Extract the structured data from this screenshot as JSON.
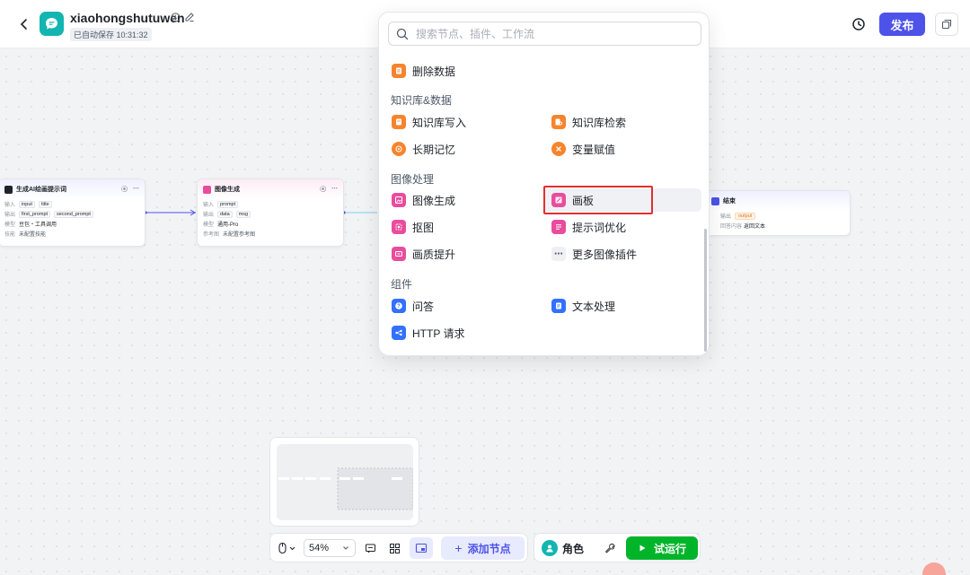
{
  "header": {
    "app_name": "xiaohongshutuwen",
    "save_status": "已自动保存 10:31:32",
    "publish_label": "发布",
    "icons": {
      "back": "chevron-left-icon",
      "logo": "chat-bubble-icon",
      "info": "info-icon",
      "edit": "edit-icon",
      "history": "history-icon",
      "copy": "copy-icon"
    }
  },
  "nodes": {
    "prompt_gen": {
      "title": "生成AI绘画提示词",
      "input_label": "输入",
      "inputs": [
        "input",
        "title"
      ],
      "output_label": "输出",
      "outputs": [
        "first_prompt",
        "second_prompt"
      ],
      "model_label": "模型",
      "model": "豆包・工具调用",
      "skill_label": "技能",
      "skill": "未配置技能"
    },
    "image_gen": {
      "title": "图像生成",
      "input_label": "输入",
      "input": "prompt",
      "output_label": "输出",
      "outputs": [
        "data",
        "msg"
      ],
      "model_label": "模型",
      "model": "通用-Pro",
      "ref_label": "参考图",
      "ref": "未配置参考图"
    },
    "end": {
      "title": "结束",
      "output_label": "输出",
      "output": "output",
      "answer_label": "回答内容",
      "answer": "返回文本"
    }
  },
  "panel": {
    "search_placeholder": "搜索节点、插件、工作流",
    "top_item": "删除数据",
    "categories": [
      {
        "title": "知识库&数据",
        "items": [
          {
            "label": "知识库写入",
            "color": "#f7842d"
          },
          {
            "label": "知识库检索",
            "color": "#f7842d"
          },
          {
            "label": "长期记忆",
            "color": "#f7842d"
          },
          {
            "label": "变量赋值",
            "color": "#f7842d"
          }
        ]
      },
      {
        "title": "图像处理",
        "items": [
          {
            "label": "图像生成",
            "color": "#ea4c9d"
          },
          {
            "label": "画板",
            "color": "#ea4c9d"
          },
          {
            "label": "抠图",
            "color": "#ea4c9d"
          },
          {
            "label": "提示词优化",
            "color": "#ea4c9d"
          },
          {
            "label": "画质提升",
            "color": "#ea4c9d"
          },
          {
            "label": "更多图像插件",
            "color": "#8f959e"
          }
        ]
      },
      {
        "title": "组件",
        "items": [
          {
            "label": "问答",
            "color": "#3370ff"
          },
          {
            "label": "文本处理",
            "color": "#3370ff"
          },
          {
            "label": "HTTP 请求",
            "color": "#3370ff"
          }
        ]
      }
    ]
  },
  "toolbar": {
    "zoom": "54%",
    "add_node_label": "添加节点",
    "role_label": "角色",
    "test_run_label": "试运行"
  },
  "colors": {
    "primary": "#4d53e8",
    "success": "#00b42a",
    "highlight_border": "#e0302f"
  }
}
